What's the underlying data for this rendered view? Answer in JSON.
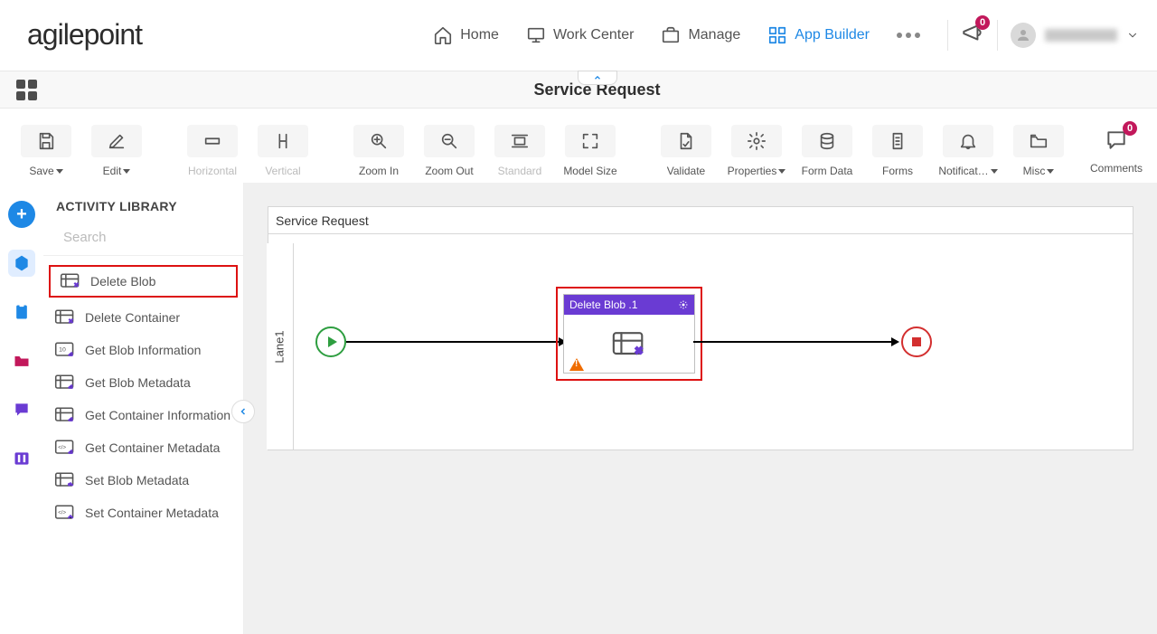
{
  "logo_text": "agilepoint",
  "nav": {
    "home": "Home",
    "work_center": "Work Center",
    "manage": "Manage",
    "app_builder": "App Builder"
  },
  "notifications_count": "0",
  "page_title": "Service Request",
  "toolbar": {
    "save": "Save",
    "edit": "Edit",
    "horizontal": "Horizontal",
    "vertical": "Vertical",
    "zoom_in": "Zoom In",
    "zoom_out": "Zoom Out",
    "standard": "Standard",
    "model_size": "Model Size",
    "validate": "Validate",
    "properties": "Properties",
    "form_data": "Form Data",
    "forms": "Forms",
    "notifications": "Notificat…",
    "misc": "Misc",
    "comments": "Comments",
    "comments_badge": "0"
  },
  "sidebar": {
    "title": "ACTIVITY LIBRARY",
    "search_placeholder": "Search",
    "items": [
      "Delete Blob",
      "Delete Container",
      "Get Blob Information",
      "Get Blob Metadata",
      "Get Container Information",
      "Get Container Metadata",
      "Set Blob Metadata",
      "Set Container Metadata"
    ]
  },
  "canvas": {
    "process_title": "Service Request",
    "lane_label": "Lane1",
    "activity_title": "Delete Blob .1"
  }
}
